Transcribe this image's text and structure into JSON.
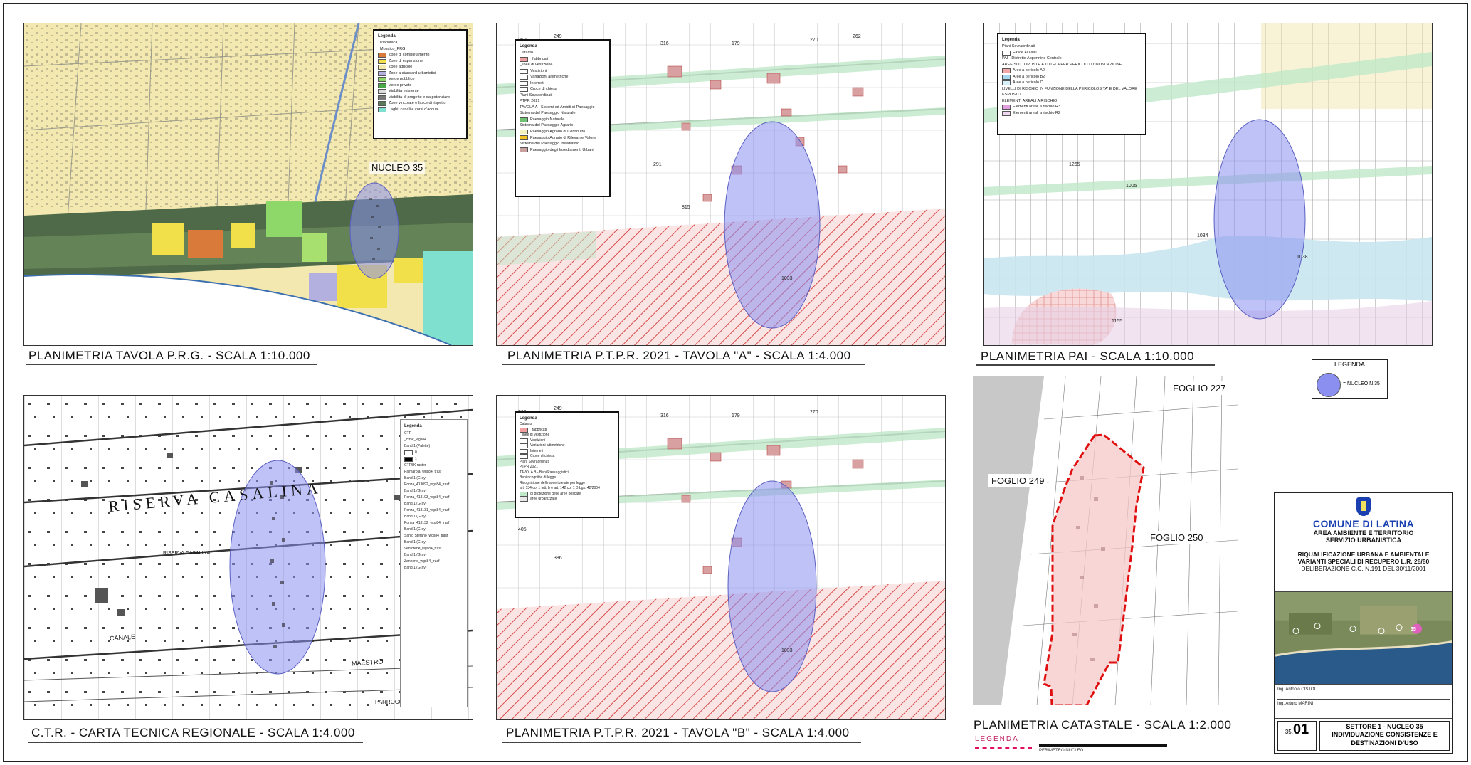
{
  "panels": {
    "prg": {
      "caption": "PLANIMETRIA TAVOLA P.R.G. - SCALA 1:10.000",
      "nucleo_label": "NUCLEO 35",
      "legend": {
        "title": "Legenda",
        "items": [
          "Planotaca",
          "Mosaico_PRG",
          "Zone di completamento",
          "Zone di espansione",
          "Zone agricole",
          "Zone a standard urbanistici",
          "Verde pubblico",
          "Verde privato",
          "Viabilità esistente",
          "Viabilità di progetto e da potenziare",
          "Zone vincolate e fasce di rispetto",
          "Laghi, canali e corsi d'acqua"
        ],
        "colors": [
          "#ffffff",
          "#ffffff",
          "#d97a3a",
          "#f2e04a",
          "#f3eab0",
          "#b3b0e0",
          "#8ed86a",
          "#4aa84a",
          "#dddddd",
          "#777777",
          "#5a7a5a",
          "#7fe0d0"
        ]
      }
    },
    "ptpr_a": {
      "caption": "PLANIMETRIA P.T.P.R. 2021 - TAVOLA \"A\" - SCALA 1:4.000",
      "legend": {
        "title": "Legenda",
        "items": [
          "Catasto",
          "_fabbricati",
          "_linee di vestizione",
          "Vestizioni",
          "Variazioni altimetriche",
          "Interneti",
          "Croce di chiesa",
          "Piani Sovraordinati",
          "PTPR 2021",
          "TAVOLA A - Sistemi ed Ambiti di Paesaggio",
          "Sistema del Paesaggio Naturale",
          "Paesaggio Naturale",
          "Sistema del Paesaggio Agrario",
          "Paesaggio Agrario di Continuità",
          "Paesaggio Agrario di Rilevante Valore",
          "Sistema del Paesaggio Insediativo",
          "Paesaggio degli Insediamenti Urbani"
        ]
      }
    },
    "pai": {
      "caption": "PLANIMETRIA PAI - SCALA 1:10.000",
      "legend": {
        "title": "Legenda",
        "items": [
          "Piani Sovraordinati",
          "Fasce Fluviali",
          "PAI - Distretto Appennino Centrale",
          "AREE SOTTOPOSTE A TUTELA PER PERICOLO D'INONDAZIONE",
          "Aree a pericolo A2",
          "Aree a pericolo B2",
          "Aree a pericolo C",
          "LIVELLI DI RISCHIO IN FUNZIONE DELLA PERICOLOSITA' E DEL VALORE ESPOSTO",
          "ELEMENTI AREALI A RISCHIO",
          "Elementi areali a rischio R3",
          "Elementi areali a rischio R2"
        ]
      }
    },
    "ctr": {
      "caption": "C.T.R. - CARTA TECNICA REGIONALE - SCALA 1:4.000",
      "map_labels": [
        "RISERVA CASALINA",
        "RISERVA CASALINA",
        "CANALE",
        "MAESTRO",
        "PARROCCHIA STELLA"
      ],
      "legend": {
        "title": "Legenda",
        "items": [
          "CTR",
          "_ctr5k_wgs84",
          "Band 1 (Palette)",
          "0",
          "1",
          "CTR5K raster",
          "Palmarola_wgs84_trasf",
          "Band 1 (Gray)",
          "Ponza_413092_wgs84_trasf",
          "Band 1 (Gray)",
          "Ponza_413103_wgs84_trasf",
          "Band 1 (Gray)",
          "Ponza_413131_wgs84_trasf",
          "Band 1 (Gray)",
          "Ponza_413132_wgs84_trasf",
          "Band 1 (Gray)",
          "Santo Stefano_wgs84_trasf",
          "Band 1 (Gray)",
          "Ventotene_wgs84_trasf",
          "Band 1 (Gray)",
          "Zannone_wgs84_trasf",
          "Band 1 (Gray)"
        ]
      }
    },
    "ptpr_b": {
      "caption": "PLANIMETRIA P.T.P.R. 2021 - TAVOLA \"B\" - SCALA 1:4.000",
      "legend": {
        "title": "Legenda",
        "items": [
          "Catasto",
          "_fabbricati",
          "_linee di vestizione",
          "Vestizioni",
          "Variazioni altimetriche",
          "Interneti",
          "Croce di chiesa",
          "Piani Sovraordinati",
          "PTPR 2021",
          "TAVOLA B - Beni Paesaggistici",
          "Beni ricognitivi di legge",
          "Ricognizione delle aree tutelate per legge",
          "art. 134 co. 1 lett. b e art. 142 co. 1 D.Lgs. 42/2004",
          "c) protezione delle aree boscate",
          "aree urbanizzate"
        ]
      }
    },
    "catastale": {
      "caption": "PLANIMETRIA CATASTALE - SCALA 1:2.000",
      "fogli": [
        "FOGLIO 227",
        "FOGLIO 249",
        "FOGLIO 250"
      ],
      "legenda_label": "LEGENDA",
      "legenda_text": "PERIMETRO NUCLEO"
    }
  },
  "main_legend": {
    "title": "LEGENDA",
    "item": "= NUCLEO N.35"
  },
  "title_block": {
    "comune": "COMUNE DI LATINA",
    "area": "AREA AMBIENTE E TERRITORIO",
    "servizio": "SERVIZIO URBANISTICA",
    "project_line1": "RIQUALIFICAZIONE URBANA E AMBIENTALE",
    "project_line2": "VARIANTI SPECIALI DI RECUPERO L.R. 28/80",
    "delibera": "DELIBERAZIONE C.C. N.191 DEL 30/11/2001",
    "sign1": "Ing. Antonio CISTOLI",
    "sign2": "Ing. Arturo MARINI",
    "sheet_prefix": "35.",
    "sheet_number": "01",
    "sheet_title_1": "SETTORE 1 - NUCLEO 35",
    "sheet_title_2": "INDIVIDUAZIONE CONSISTENZE E",
    "sheet_title_3": "DESTINAZIONI D'USO",
    "ortho_marker": "35"
  },
  "colors": {
    "nucleo_fill": "#8a8ff0",
    "hatch": "#d84a4a",
    "perimeter": "#e01010",
    "prg_base": "#f2e8b0",
    "title_blue": "#1a3fb0"
  }
}
